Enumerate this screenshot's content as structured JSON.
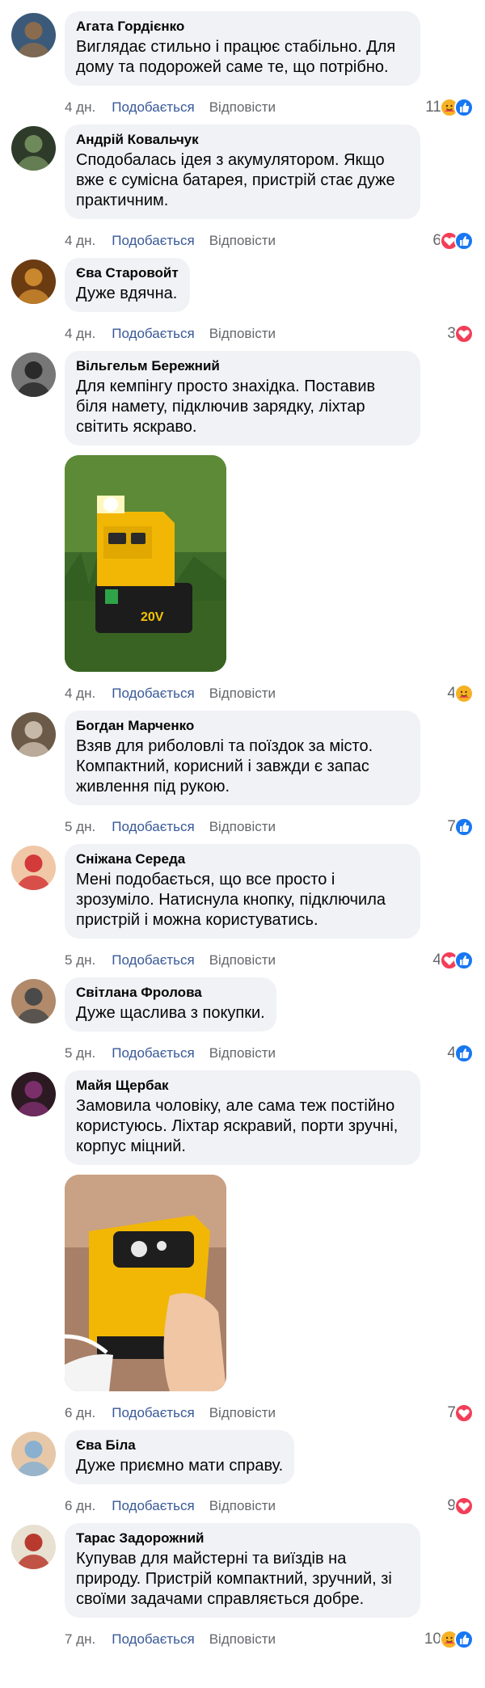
{
  "labels": {
    "like": "Подобається",
    "reply": "Відповісти"
  },
  "comments": [
    {
      "author": "Агата Гордієнко",
      "text": "Виглядає стильно і працює стабільно. Для дому та подорожей саме те, що потрібно.",
      "time": "4 дн.",
      "reaction_count": "11",
      "reactions": [
        "care",
        "like"
      ],
      "avatar": [
        "#8a6b4e",
        "#3b5a7a"
      ]
    },
    {
      "author": "Андрій Ковальчук",
      "text": "Сподобалась ідея з акумулятором. Якщо вже є сумісна батарея, пристрій стає дуже практичним.",
      "time": "4 дн.",
      "reaction_count": "6",
      "reactions": [
        "love",
        "like"
      ],
      "avatar": [
        "#6f8a5a",
        "#2e3b2a"
      ]
    },
    {
      "author": "Єва Старовойт",
      "text": "Дуже вдячна.",
      "time": "4 дн.",
      "reaction_count": "3",
      "reactions": [
        "love"
      ],
      "avatar": [
        "#c9872e",
        "#6b3b12"
      ]
    },
    {
      "author": "Вільгельм Бережний",
      "text": "Для кемпінгу просто знахідка. Поставив біля намету, підключив зарядку, ліхтар світить яскраво.",
      "time": "4 дн.",
      "reaction_count": "4",
      "reactions": [
        "care"
      ],
      "avatar": [
        "#2a2a2a",
        "#777777"
      ],
      "photo": "green"
    },
    {
      "author": "Богдан Марченко",
      "text": "Взяв для риболовлі та поїздок за місто. Компактний, корисний і завжди є запас живлення під рукою.",
      "time": "5 дн.",
      "reaction_count": "7",
      "reactions": [
        "like"
      ],
      "avatar": [
        "#c7b9a8",
        "#6b5a48"
      ]
    },
    {
      "author": "Сніжана Середа",
      "text": "Мені подобається, що все просто і зрозуміло. Натиснула кнопку, підключила пристрій і можна користуватись.",
      "time": "5 дн.",
      "reaction_count": "4",
      "reactions": [
        "love",
        "like"
      ],
      "avatar": [
        "#d33a3a",
        "#f0c8a8"
      ]
    },
    {
      "author": "Світлана Фролова",
      "text": "Дуже щаслива з покупки.",
      "time": "5 дн.",
      "reaction_count": "4",
      "reactions": [
        "like"
      ],
      "avatar": [
        "#4a4a4a",
        "#b08a6a"
      ]
    },
    {
      "author": "Майя Щербак",
      "text": "Замовила чоловіку, але сама теж постійно користуюсь. Ліхтар яскравий, порти зручні, корпус міцний.",
      "time": "6 дн.",
      "reaction_count": "7",
      "reactions": [
        "love"
      ],
      "avatar": [
        "#7a2f6a",
        "#2c1a22"
      ],
      "photo": "hand"
    },
    {
      "author": "Єва Біла",
      "text": "Дуже приємно мати справу.",
      "time": "6 дн.",
      "reaction_count": "9",
      "reactions": [
        "love"
      ],
      "avatar": [
        "#8ab0d0",
        "#e6c8a8"
      ]
    },
    {
      "author": "Тарас Задорожний",
      "text": "Купував для майстерні та виїздів на природу. Пристрій компактний, зручний, зі своїми задачами справляється добре.",
      "time": "7 дн.",
      "reaction_count": "10",
      "reactions": [
        "care",
        "like"
      ],
      "avatar": [
        "#b83a2e",
        "#e8e0d0"
      ]
    }
  ],
  "colors": {
    "like": "#1877f2",
    "love": "#f33e58",
    "care": "#f7b125",
    "link": "#385898"
  }
}
